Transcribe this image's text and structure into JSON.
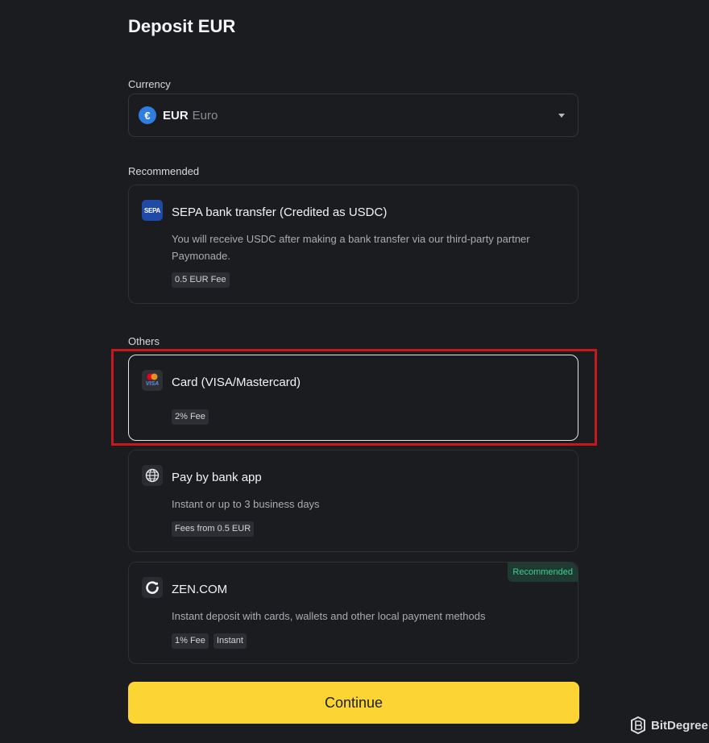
{
  "page": {
    "title": "Deposit EUR"
  },
  "currency": {
    "label": "Currency",
    "symbol": "€",
    "code": "EUR",
    "name": "Euro",
    "icon": "chevron-down-icon"
  },
  "recommended": {
    "label": "Recommended",
    "sepa": {
      "icon_text": "SEPA",
      "name": "SEPA bank transfer (Credited as USDC)",
      "description": "You will receive USDC after making a bank transfer via our third-party partner Paymonade.",
      "tags": [
        "0.5 EUR Fee"
      ]
    }
  },
  "others": {
    "label": "Others",
    "card": {
      "icon_text": "VISA",
      "name": "Card (VISA/Mastercard)",
      "tags": [
        "2% Fee"
      ],
      "selected": true
    },
    "bank_app": {
      "icon": "globe-icon",
      "name": "Pay by bank app",
      "description": "Instant or up to 3 business days",
      "tags": [
        "Fees from 0.5 EUR"
      ]
    },
    "zen": {
      "icon": "zen-logo-icon",
      "name": "ZEN.COM",
      "badge": "Recommended",
      "description": "Instant deposit with cards, wallets and other local payment methods",
      "tags": [
        "1% Fee",
        "Instant"
      ]
    }
  },
  "actions": {
    "continue_label": "Continue"
  },
  "watermark": {
    "text": "BitDegree"
  },
  "colors": {
    "background": "#1b1c1f",
    "accent": "#fcd535",
    "highlight": "#c8181f",
    "success": "#3fcf8e"
  }
}
